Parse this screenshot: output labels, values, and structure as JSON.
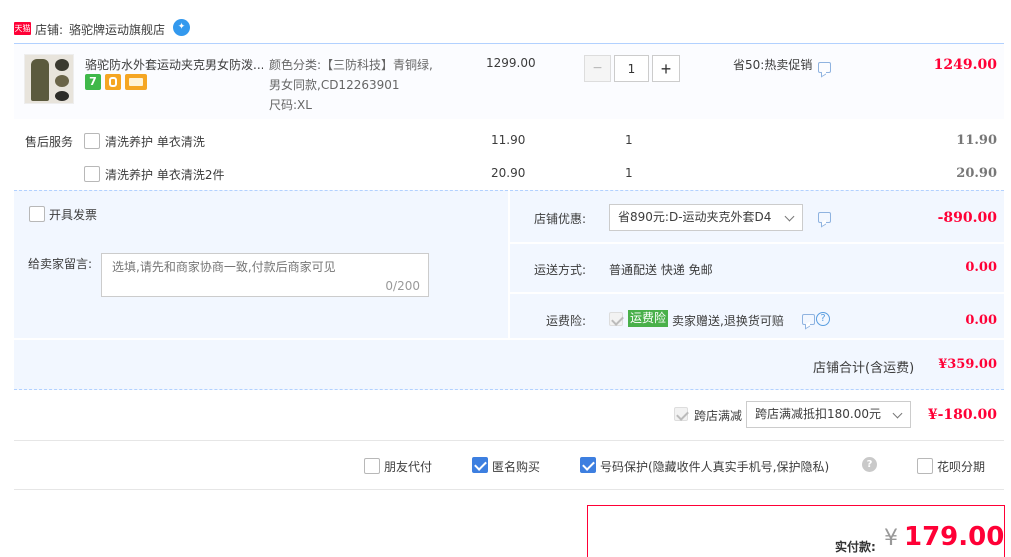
{
  "shop": {
    "badge": "天猫",
    "label": "店铺:",
    "name": "骆驼牌运动旗舰店"
  },
  "item": {
    "title": "骆驼防水外套运动夹克男女防泼...",
    "sku_line1": "颜色分类:【三防科技】青铜绿,",
    "sku_line2": "男女同款,CD12263901",
    "sku_line3": "尺码:XL",
    "price": "1299.00",
    "qty": "1",
    "qty_minus": "−",
    "qty_plus": "+",
    "promo": "省50:热卖促销",
    "subtotal": "1249.00"
  },
  "after_sale": {
    "label": "售后服务",
    "options": [
      {
        "name": "清洗养护 单衣清洗",
        "price": "11.90",
        "qty": "1",
        "total": "11.90"
      },
      {
        "name": "清洗养护 单衣清洗2件",
        "price": "20.90",
        "qty": "1",
        "total": "20.90"
      }
    ]
  },
  "order": {
    "invoice_label": "开具发票",
    "message_label": "给卖家留言:",
    "message_placeholder": "选填,请先和商家协商一致,付款后商家可见",
    "message_counter": "0/200",
    "shop_discount_label": "店铺优惠:",
    "shop_discount_value": "省890元:D-运动夹克外套D4",
    "shop_discount_amount": "-890.00",
    "shipping_label": "运送方式:",
    "shipping_value": "普通配送 快递 免邮",
    "shipping_amount": "0.00",
    "insurance_label": "运费险:",
    "insurance_badge": "运费险",
    "insurance_desc": "卖家赠送,退换货可赔",
    "insurance_amount": "0.00",
    "shop_total_label": "店铺合计(含运费)",
    "shop_total": "¥359.00"
  },
  "cross_store": {
    "label": "跨店满减",
    "select_value": "跨店满减抵扣180.00元",
    "amount": "¥-180.00"
  },
  "options": {
    "friend_pay": "朋友代付",
    "anonymous": "匿名购买",
    "number_protect": "号码保护(隐藏收件人真实手机号,保护隐私)",
    "huabei": "花呗分期"
  },
  "payment": {
    "label": "实付款:",
    "currency": "¥",
    "amount": "179.00"
  },
  "colors": {
    "accent_red": "#ff0036",
    "panel_blue": "#f2f7ff",
    "checkbox_blue": "#3d7fe0",
    "tmall_red": "#ff0036",
    "insurance_green": "#49b04a"
  }
}
